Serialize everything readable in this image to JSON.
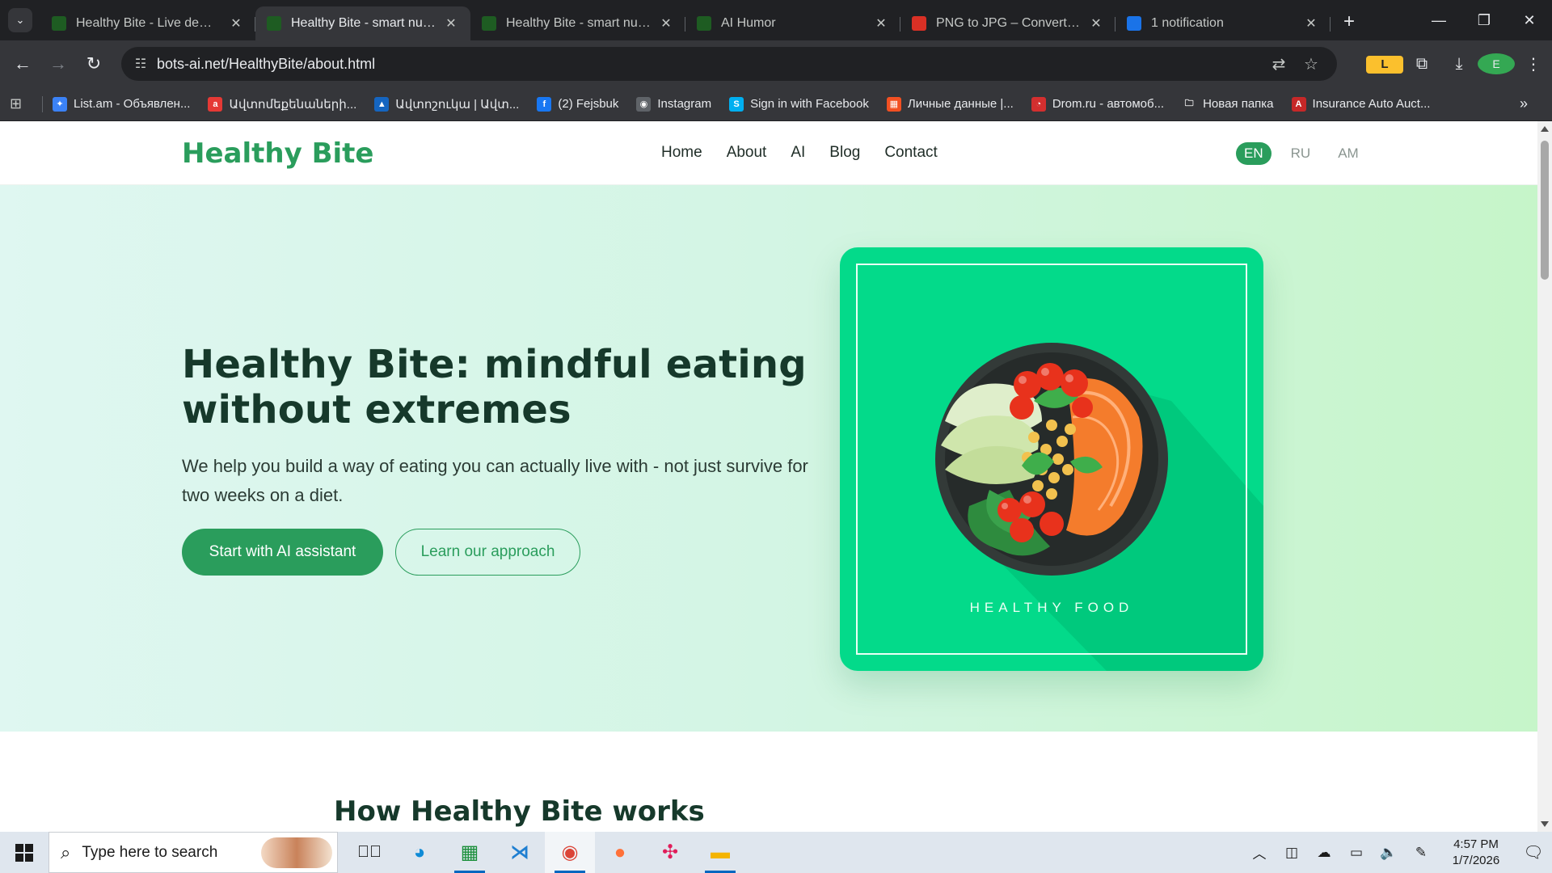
{
  "browser": {
    "tabs": [
      {
        "title": "Healthy Bite - Live demo | AI",
        "favicon_color": "#1e5c22",
        "active": false
      },
      {
        "title": "Healthy Bite - smart nutrition",
        "favicon_color": "#1e5c22",
        "active": true
      },
      {
        "title": "Healthy Bite - smart nutrition",
        "favicon_color": "#1e5c22",
        "active": false
      },
      {
        "title": "AI Humor",
        "favicon_color": "#1e5c22",
        "active": false
      },
      {
        "title": "PNG to JPG – Convert PNG",
        "favicon_color": "#d93025",
        "active": false
      },
      {
        "title": "1 notification",
        "favicon_color": "#1a73e8",
        "active": false
      }
    ],
    "url": "bots-ai.net/HealthyBite/about.html",
    "bookmarks": [
      {
        "label": "List.am - Объявлен...",
        "color": "#3b82f6",
        "glyph": "✦"
      },
      {
        "label": "Ավտոմեքենաների...",
        "color": "#e53935",
        "glyph": "a"
      },
      {
        "label": "Ավտոշուկա | Ավտ...",
        "color": "#1565c0",
        "glyph": "▲"
      },
      {
        "label": "(2) Fejsbuk",
        "color": "#1877f2",
        "glyph": "f"
      },
      {
        "label": "Instagram",
        "color": "#5f6368",
        "glyph": "◉"
      },
      {
        "label": "Sign in with Facebook",
        "color": "#00aff0",
        "glyph": "S"
      },
      {
        "label": "Личные данные |...",
        "color": "#f25022",
        "glyph": "▦"
      },
      {
        "label": "Drom.ru - автомоб...",
        "color": "#d32f2f",
        "glyph": "◔"
      },
      {
        "label": "Новая папка",
        "color": "#35363a",
        "glyph": "🗀"
      },
      {
        "label": "Insurance Auto Auct...",
        "color": "#c62828",
        "glyph": "A"
      }
    ]
  },
  "site": {
    "logo": "Healthy Bite",
    "nav": [
      "Home",
      "About",
      "AI",
      "Blog",
      "Contact"
    ],
    "languages": [
      {
        "code": "EN",
        "active": true
      },
      {
        "code": "RU",
        "active": false
      },
      {
        "code": "AM",
        "active": false
      }
    ],
    "hero": {
      "title": "Healthy Bite: mindful eating without extremes",
      "subtitle": "We help you build a way of eating you can actually live with - not just survive for two weeks on a diet.",
      "primary_cta": "Start with AI assistant",
      "secondary_cta": "Learn our approach",
      "image_caption": "HEALTHY FOOD"
    },
    "section2_title": "How Healthy Bite works"
  },
  "taskbar": {
    "search_placeholder": "Type here to search",
    "time": "4:57 PM",
    "date": "1/7/2026"
  },
  "colors": {
    "brand_green": "#2a9d5c",
    "card_green": "#03da8a"
  }
}
